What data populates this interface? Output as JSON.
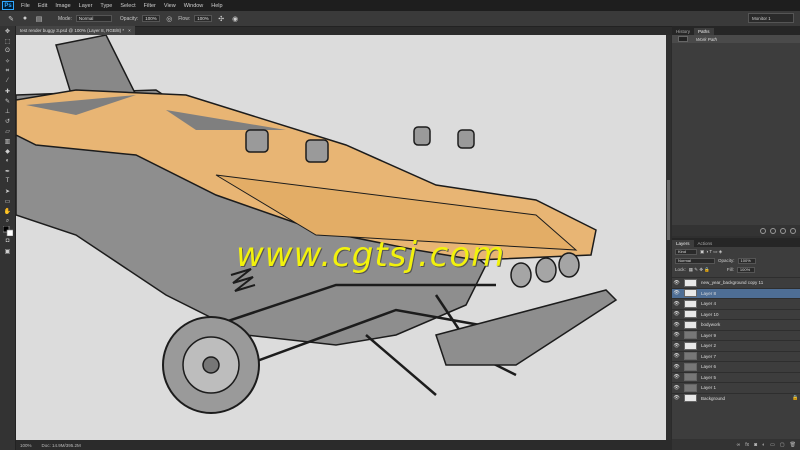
{
  "app": {
    "logo": "Ps"
  },
  "menu": [
    "File",
    "Edit",
    "Image",
    "Layer",
    "Type",
    "Select",
    "Filter",
    "View",
    "Window",
    "Help"
  ],
  "options": {
    "mode_label": "Mode:",
    "mode_value": "Normal",
    "opacity_label": "Opacity:",
    "opacity_value": "100%",
    "flow_label": "Flow:",
    "flow_value": "100%",
    "workspace": "Monitor 1"
  },
  "document": {
    "tab_title": "test render buggy 3.psd @ 100% (Layer 8, RGB/8) *",
    "zoom": "100%",
    "doc_size": "Doc: 14.9M/395.2M",
    "watermark": "www.cgtsj.com"
  },
  "panels": {
    "history_tab": "History",
    "paths_tab": "Paths",
    "work_path": "Work Path",
    "layers_tab": "Layers",
    "actions_tab": "Actions",
    "kind_label": "Kind",
    "blend_mode": "Normal",
    "opacity_label": "Opacity:",
    "opacity_value": "100%",
    "lock_label": "Lock:",
    "fill_label": "Fill:",
    "fill_value": "100%"
  },
  "layers": [
    {
      "name": "new_year_background copy 11",
      "selected": false,
      "dark": false,
      "locked": false
    },
    {
      "name": "Layer 8",
      "selected": true,
      "dark": false,
      "locked": false
    },
    {
      "name": "Layer 4",
      "selected": false,
      "dark": false,
      "locked": false
    },
    {
      "name": "Layer 10",
      "selected": false,
      "dark": false,
      "locked": false
    },
    {
      "name": "bodywork",
      "selected": false,
      "dark": false,
      "locked": false
    },
    {
      "name": "Layer 9",
      "selected": false,
      "dark": true,
      "locked": false
    },
    {
      "name": "Layer 2",
      "selected": false,
      "dark": false,
      "locked": false
    },
    {
      "name": "Layer 7",
      "selected": false,
      "dark": true,
      "locked": false
    },
    {
      "name": "Layer 6",
      "selected": false,
      "dark": true,
      "locked": false
    },
    {
      "name": "Layer 5",
      "selected": false,
      "dark": true,
      "locked": false
    },
    {
      "name": "Layer 1",
      "selected": false,
      "dark": true,
      "locked": false
    },
    {
      "name": "Background",
      "selected": false,
      "dark": false,
      "locked": true
    }
  ],
  "colors": {
    "accent": "#4e6e95",
    "sketch_fill": "#e8b574",
    "watermark": "#f2f20c"
  }
}
